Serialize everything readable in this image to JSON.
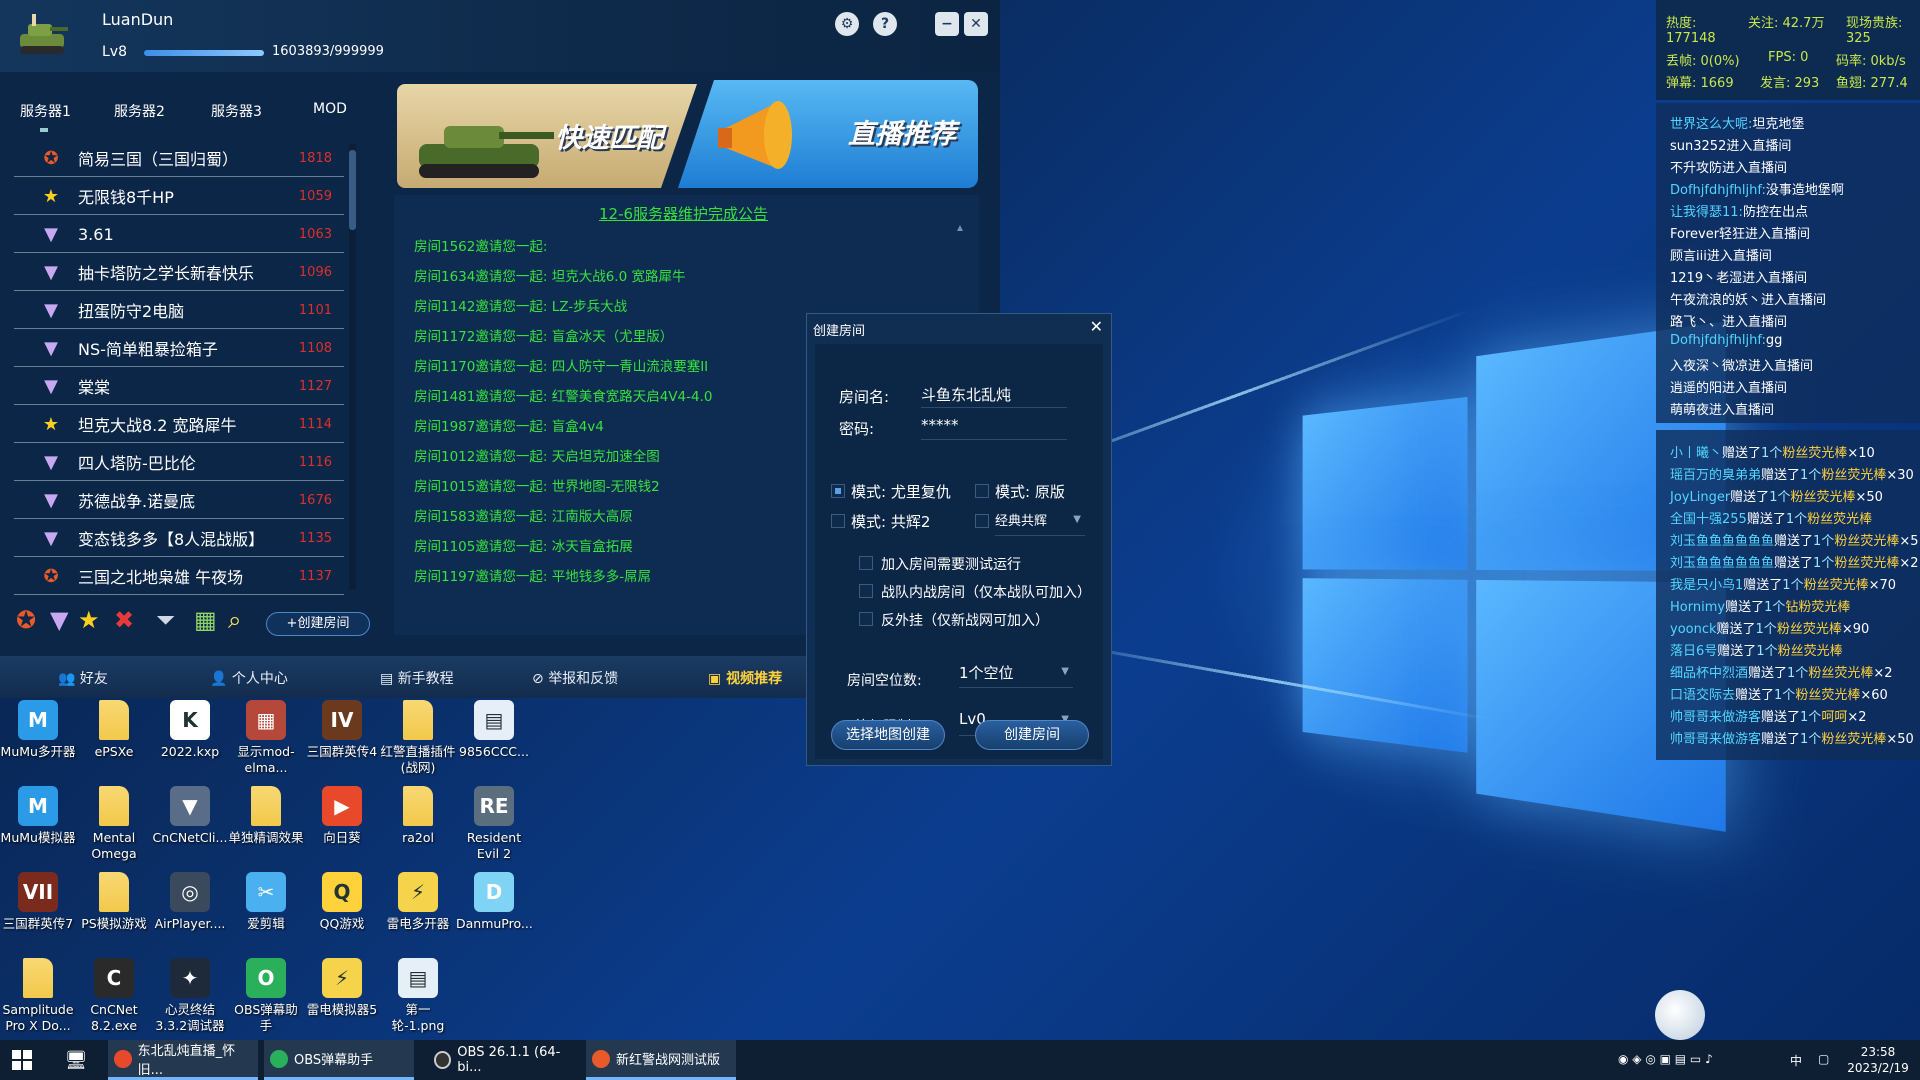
{
  "game": {
    "username": "LuanDun",
    "level": "Lv8",
    "xp": "1603893/999999",
    "xp_fraction": 1.0,
    "server_tabs": [
      "服务器1",
      "服务器2",
      "服务器3",
      "MOD"
    ],
    "rooms": [
      {
        "icon": "crown-star-icon",
        "name": "简易三国（三国归蜀）",
        "num": "1818"
      },
      {
        "icon": "star-icon",
        "name": "无限钱8千HP",
        "num": "1059"
      },
      {
        "icon": "cnc-icon",
        "name": "3.61",
        "num": "1063"
      },
      {
        "icon": "cnc-icon",
        "name": "抽卡塔防之学长新春快乐",
        "num": "1096"
      },
      {
        "icon": "cnc-icon",
        "name": "扭蛋防守2电脑",
        "num": "1101"
      },
      {
        "icon": "cnc-icon",
        "name": "NS-简单粗暴捡箱子",
        "num": "1108"
      },
      {
        "icon": "cnc-icon",
        "name": "棠棠",
        "num": "1127"
      },
      {
        "icon": "star-icon",
        "name": "坦克大战8.2 宽路犀牛",
        "num": "1114"
      },
      {
        "icon": "cnc-icon",
        "name": "四人塔防-巴比伦",
        "num": "1116"
      },
      {
        "icon": "cnc-icon",
        "name": "苏德战争.诺曼底",
        "num": "1676"
      },
      {
        "icon": "cnc-icon",
        "name": "变态钱多多【8人混战版】",
        "num": "1135"
      },
      {
        "icon": "crown-star-icon",
        "name": "三国之北地枭雄 午夜场",
        "num": "1137"
      }
    ],
    "create_room_label": "+创建房间",
    "banner_quick_match": "快速匹配",
    "banner_live": "直播推荐",
    "notice_title": "12-6服务器维护完成公告",
    "invites": [
      "房间1562邀请您一起:",
      "房间1634邀请您一起: 坦克大战6.0 宽路犀牛",
      "房间1142邀请您一起: LZ-步兵大战",
      "房间1172邀请您一起: 盲盒冰天（尤里版）",
      "房间1170邀请您一起: 四人防守一青山流浪要塞II",
      "房间1481邀请您一起: 红警美食宽路天启4V4-4.0",
      "房间1987邀请您一起: 盲盒4v4",
      "房间1012邀请您一起: 天启坦克加速全图",
      "房间1015邀请您一起: 世界地图-无限钱2",
      "房间1583邀请您一起: 江南版大高原",
      "房间1105邀请您一起: 冰天盲盒拓展",
      "房间1197邀请您一起: 平地钱多多-屌屌"
    ],
    "nav": [
      "好友",
      "个人中心",
      "新手教程",
      "举报和反馈",
      "视频推荐"
    ]
  },
  "dialog": {
    "title": "创建房间",
    "room_name_label": "房间名:",
    "room_name_value": "斗鱼东北乱炖",
    "password_label": "密码:",
    "password_value": "*****",
    "mode1": "模式: 尤里复仇",
    "mode2": "模式: 原版",
    "mode3": "模式: 共辉2",
    "mode4": "经典共辉",
    "opt1": "加入房间需要测试运行",
    "opt2": "战队内战房间（仅本战队可加入）",
    "opt3": "反外挂（仅新战网可加入）",
    "slots_label": "房间空位数:",
    "slots_value": "1个空位",
    "level_label": "等级限制:",
    "level_value": "Lv0",
    "btn_map": "选择地图创建",
    "btn_create": "创建房间"
  },
  "overlay": {
    "stats": {
      "heat_label": "热度:",
      "heat": "177148",
      "follow": "关注: 42.7万",
      "nobles_label": "现场贵族:",
      "nobles": "325",
      "frames": "丢帧: 0(0%)",
      "fps": "FPS: 0",
      "bitrate": "码率: 0kb/s",
      "danmu": "弹幕: 1669",
      "speak": "发言: 293",
      "fishball": "鱼翅: 277.4"
    },
    "chat": [
      {
        "u": "世界这么大呢:",
        "t": "坦克地堡"
      },
      {
        "u": "",
        "t": "sun3252进入直播间"
      },
      {
        "u": "",
        "t": "不升攻防进入直播间"
      },
      {
        "u": "Dofhjfdhjfhljhf:",
        "t": "没事造地堡啊"
      },
      {
        "u": "让我得瑟11:",
        "t": "防控在出点"
      },
      {
        "u": "",
        "t": "Forever轻狂进入直播间"
      },
      {
        "u": "",
        "t": "顾言iii进入直播间"
      },
      {
        "u": "",
        "t": "1219丶老湿进入直播间"
      },
      {
        "u": "",
        "t": "午夜流浪的妖丶进入直播间"
      },
      {
        "u": "",
        "t": "路飞丶、进入直播间"
      },
      {
        "u": "Dofhjfdhjfhljhf:",
        "t": "gg"
      },
      {
        "u": "",
        "t": "入夜深丶微凉进入直播间"
      },
      {
        "u": "",
        "t": "逍遥的阳进入直播间"
      },
      {
        "u": "",
        "t": "萌萌夜进入直播间"
      }
    ],
    "gifts": [
      {
        "u": "小丨曦丶",
        "t": "赠送了",
        "n": "1个",
        "g": "粉丝荧光棒",
        "c": "×10"
      },
      {
        "u": "瑶百万的臭弟弟",
        "t": "赠送了",
        "n": "1个",
        "g": "粉丝荧光棒",
        "c": "×30"
      },
      {
        "u": "JoyLinger",
        "t": "赠送了",
        "n": "1个",
        "g": "粉丝荧光棒",
        "c": "×50"
      },
      {
        "u": "全国十强255",
        "t": "赠送了",
        "n": "1个",
        "g": "粉丝荧光棒",
        "c": ""
      },
      {
        "u": "刘玉鱼鱼鱼鱼鱼鱼",
        "t": "赠送了",
        "n": "1个",
        "g": "粉丝荧光棒",
        "c": "×5"
      },
      {
        "u": "刘玉鱼鱼鱼鱼鱼鱼",
        "t": "赠送了",
        "n": "1个",
        "g": "粉丝荧光棒",
        "c": "×2"
      },
      {
        "u": "我是只小鸟1",
        "t": "赠送了",
        "n": "1个",
        "g": "粉丝荧光棒",
        "c": "×70"
      },
      {
        "u": "Hornimy",
        "t": "赠送了",
        "n": "1个",
        "g": "钻粉荧光棒",
        "c": ""
      },
      {
        "u": "yoonck",
        "t": "赠送了",
        "n": "1个",
        "g": "粉丝荧光棒",
        "c": "×90"
      },
      {
        "u": "落日6号",
        "t": "赠送了",
        "n": "1个",
        "g": "粉丝荧光棒",
        "c": ""
      },
      {
        "u": "细品杯中烈酒",
        "t": "赠送了",
        "n": "1个",
        "g": "粉丝荧光棒",
        "c": "×2"
      },
      {
        "u": "口语交际去",
        "t": "赠送了",
        "n": "1个",
        "g": "粉丝荧光棒",
        "c": "×60"
      },
      {
        "u": "帅哥哥来做游客",
        "t": "赠送了",
        "n": "1个",
        "g": "呵呵",
        "c": "×2"
      },
      {
        "u": "帅哥哥来做游客",
        "t": "赠送了",
        "n": "1个",
        "g": "粉丝荧光棒",
        "c": "×50"
      }
    ]
  },
  "desktop": [
    {
      "label": "MuMu多开器",
      "color": "#2b9be8",
      "glyph": "M"
    },
    {
      "label": "ePSXe",
      "color": "#f2c94c",
      "glyph": ""
    },
    {
      "label": "2022.kxp",
      "color": "#ffffff",
      "glyph": "K"
    },
    {
      "label": "显示mod-elma...",
      "color": "#b5483a",
      "glyph": "▦"
    },
    {
      "label": "三国群英传4",
      "color": "#6b3a1e",
      "glyph": "IV"
    },
    {
      "label": "红警直播插件(战网)",
      "color": "#f2c94c",
      "glyph": ""
    },
    {
      "label": "9856CCC...",
      "color": "#e6eef8",
      "glyph": "▤"
    },
    {
      "label": "MuMu模拟器",
      "color": "#2b9be8",
      "glyph": "M"
    },
    {
      "label": "Mental Omega",
      "color": "#f2c94c",
      "glyph": ""
    },
    {
      "label": "CnCNetCli...",
      "color": "#5a6d88",
      "glyph": "▼"
    },
    {
      "label": "单独精调效果",
      "color": "#f2c94c",
      "glyph": ""
    },
    {
      "label": "向日葵",
      "color": "#e8492a",
      "glyph": "▶"
    },
    {
      "label": "ra2ol",
      "color": "#f2c94c",
      "glyph": ""
    },
    {
      "label": "Resident Evil 2",
      "color": "#5b6e7e",
      "glyph": "RE"
    },
    {
      "label": "三国群英传7",
      "color": "#7a2b1e",
      "glyph": "VII"
    },
    {
      "label": "PS模拟游戏",
      "color": "#f2c94c",
      "glyph": ""
    },
    {
      "label": "AirPlayer....",
      "color": "#3a4a5c",
      "glyph": "◎"
    },
    {
      "label": "爱剪辑",
      "color": "#4ab0f0",
      "glyph": "✂"
    },
    {
      "label": "QQ游戏",
      "color": "#ffd23c",
      "glyph": "Q"
    },
    {
      "label": "雷电多开器",
      "color": "#f5d34a",
      "glyph": "⚡"
    },
    {
      "label": "DanmuPro...",
      "color": "#7fd3f5",
      "glyph": "D"
    },
    {
      "label": "Samplitude Pro X Do...",
      "color": "#f2c94c",
      "glyph": ""
    },
    {
      "label": "CnCNet 8.2.exe",
      "color": "#2a2a2a",
      "glyph": "C"
    },
    {
      "label": "心灵终结3.3.2调试器",
      "color": "#1e2a3a",
      "glyph": "✦"
    },
    {
      "label": "OBS弹幕助手",
      "color": "#2ab05a",
      "glyph": "O"
    },
    {
      "label": "雷电模拟器5",
      "color": "#f5d34a",
      "glyph": "⚡"
    },
    {
      "label": "第一轮-1.png",
      "color": "#e6eef8",
      "glyph": "▤"
    }
  ],
  "taskbar": {
    "tasks": [
      "东北乱炖直播_怀旧...",
      "OBS弹幕助手",
      "OBS 26.1.1 (64-bi...",
      "新红警战网测试版"
    ],
    "ime": "中",
    "time": "23:58",
    "date": "2023/2/19"
  }
}
